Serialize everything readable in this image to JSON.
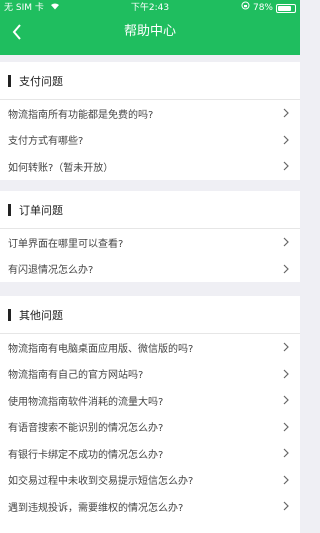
{
  "status_bar": {
    "carrier": "无 SIM 卡",
    "time": "下午2:43",
    "battery": "78%"
  },
  "header": {
    "title": "帮助中心"
  },
  "sections": [
    {
      "title": "支付问题",
      "items": [
        "物流指南所有功能都是免费的吗?",
        "支付方式有哪些?",
        "如何转账?（暂未开放）"
      ]
    },
    {
      "title": "订单问题",
      "items": [
        "订单界面在哪里可以查看?",
        "有闪退情况怎么办?"
      ]
    },
    {
      "title": "其他问题",
      "items": [
        "物流指南有电脑桌面应用版、微信版的吗?",
        "物流指南有自己的官方网站吗?",
        "使用物流指南软件消耗的流量大吗?",
        "有语音搜索不能识别的情况怎么办?",
        "有银行卡绑定不成功的情况怎么办?",
        "如交易过程中未收到交易提示短信怎么办?",
        "遇到违规投诉，需要维权的情况怎么办?"
      ]
    }
  ],
  "colors": {
    "accent": "#1fbe5f",
    "background": "#efeff4"
  }
}
